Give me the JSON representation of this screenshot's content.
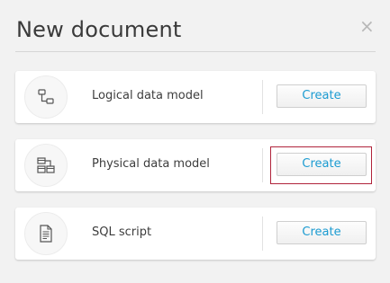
{
  "dialog": {
    "title": "New document",
    "close_glyph": "×",
    "close_icon": "close-icon"
  },
  "options": [
    {
      "label": "Logical data model",
      "button": "Create",
      "icon": "logical-model-icon"
    },
    {
      "label": "Physical data model",
      "button": "Create",
      "icon": "physical-model-icon"
    },
    {
      "label": "SQL script",
      "button": "Create",
      "icon": "sql-script-icon"
    }
  ],
  "colors": {
    "accent": "#1b9bd1",
    "highlight_border": "#b0243b",
    "background": "#f2f2f2"
  }
}
